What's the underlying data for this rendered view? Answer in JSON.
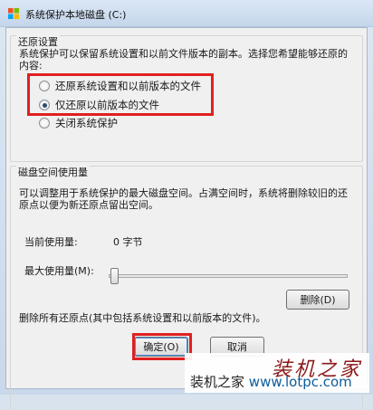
{
  "window": {
    "title": "系统保护本地磁盘 (C:)"
  },
  "restore_settings": {
    "group_label": "还原设置",
    "description": "系统保护可以保留系统设置和以前文件版本的副本。选择您希望能够还原的内容:",
    "options": [
      {
        "label": "还原系统设置和以前版本的文件",
        "checked": false
      },
      {
        "label": "仅还原以前版本的文件",
        "checked": true
      },
      {
        "label": "关闭系统保护",
        "checked": false
      }
    ]
  },
  "disk_usage": {
    "group_label": "磁盘空间使用量",
    "description": "可以调整用于系统保护的最大磁盘空间。占满空间时，系统将删除较旧的还原点以便为新还原点留出空间。",
    "current_usage_label": "当前使用量:",
    "current_usage_value": "0 字节",
    "max_usage_label": "最大使用量(M):",
    "max_usage_level": 0,
    "delete_description": "删除所有还原点(其中包括系统设置和以前版本的文件)。",
    "delete_button": "删除(D)"
  },
  "footer": {
    "ok_button": "确定(O)",
    "cancel_button": "取消"
  },
  "watermark": {
    "brand": "装机之家",
    "site_name": "装机之家",
    "site_url": "www.lotpc.com"
  },
  "colors": {
    "highlight": "#e02020",
    "watermark_red": "#8b1a1a"
  }
}
